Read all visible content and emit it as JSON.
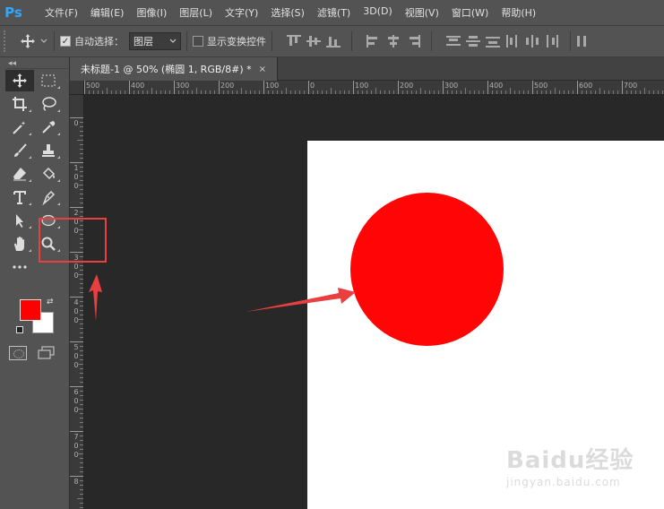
{
  "app": {
    "logo": "Ps"
  },
  "menu": [
    "文件(F)",
    "编辑(E)",
    "图像(I)",
    "图层(L)",
    "文字(Y)",
    "选择(S)",
    "滤镜(T)",
    "3D(D)",
    "视图(V)",
    "窗口(W)",
    "帮助(H)"
  ],
  "options": {
    "auto_select_label": "自动选择：",
    "auto_select_checked": true,
    "auto_select_target": "图层",
    "show_transform_label": "显示变换控件",
    "show_transform_checked": false
  },
  "document": {
    "tab_title": "未标题-1 @ 50% (椭圆 1, RGB/8#) *",
    "tab_close": "×"
  },
  "ruler": {
    "top_labels": [
      "500",
      "400",
      "300",
      "200",
      "100",
      "0",
      "100",
      "200",
      "300",
      "400",
      "500",
      "600",
      "700"
    ],
    "left_labels": [
      "0",
      "100",
      "200",
      "300",
      "400",
      "500",
      "600",
      "700",
      "8"
    ]
  },
  "colors": {
    "foreground": "#ff0000",
    "background": "#ffffff",
    "shape_fill": "#ff0505",
    "annotation": "#e84040"
  },
  "tools": [
    [
      "move-tool",
      "marquee-tool"
    ],
    [
      "crop-tool",
      "lasso-tool"
    ],
    [
      "magic-wand-tool",
      "eyedropper-tool"
    ],
    [
      "brush-tool",
      "clone-stamp-tool"
    ],
    [
      "eraser-tool",
      "paint-bucket-tool"
    ],
    [
      "type-tool",
      "pen-tool"
    ],
    [
      "path-selection-tool",
      "ellipse-tool"
    ],
    [
      "hand-tool",
      "zoom-tool"
    ]
  ],
  "watermark": {
    "brand": "Baidu经验",
    "sub": "jingyan.baidu.com"
  }
}
